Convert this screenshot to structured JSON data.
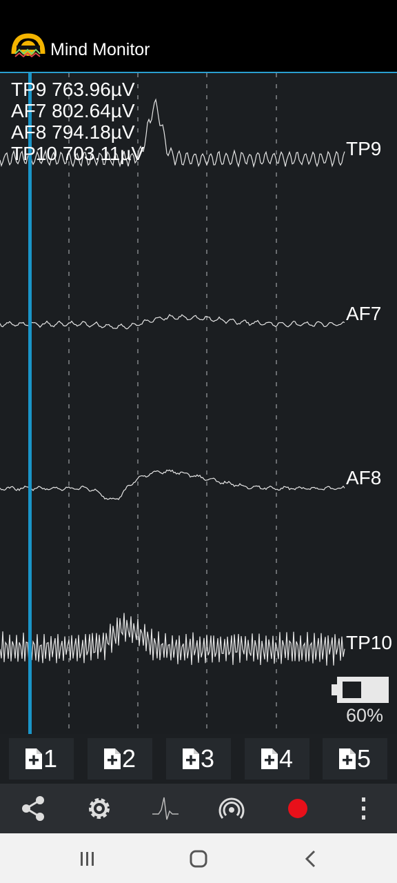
{
  "app_bar": {
    "title": "Mind Monitor",
    "logo_icon": "headband-logo-icon"
  },
  "readouts": [
    {
      "text": "TP9 763.96µV"
    },
    {
      "text": "AF7 802.64µV"
    },
    {
      "text": "AF8 794.18µV"
    },
    {
      "text": "TP10 703.11µV"
    }
  ],
  "channels": [
    {
      "label": "TP9"
    },
    {
      "label": "AF7"
    },
    {
      "label": "AF8"
    },
    {
      "label": "TP10"
    }
  ],
  "battery": {
    "percent_text": "60%",
    "level": 0.6
  },
  "markers": [
    {
      "label": "1",
      "icon": "add-document-icon"
    },
    {
      "label": "2",
      "icon": "add-document-icon"
    },
    {
      "label": "3",
      "icon": "add-document-icon"
    },
    {
      "label": "4",
      "icon": "add-document-icon"
    },
    {
      "label": "5",
      "icon": "add-document-icon"
    }
  ],
  "toolbar": {
    "icons": [
      "share-icon",
      "settings-gear-icon",
      "waveform-icon",
      "broadcast-icon",
      "record-icon",
      "more-options-icon"
    ],
    "record_color": "#e8101a"
  },
  "colors": {
    "accent": "#2a9fd0",
    "trace": "#e6e6e6"
  },
  "nav": {
    "icons": [
      "recent-apps-icon",
      "home-icon",
      "back-icon"
    ]
  }
}
